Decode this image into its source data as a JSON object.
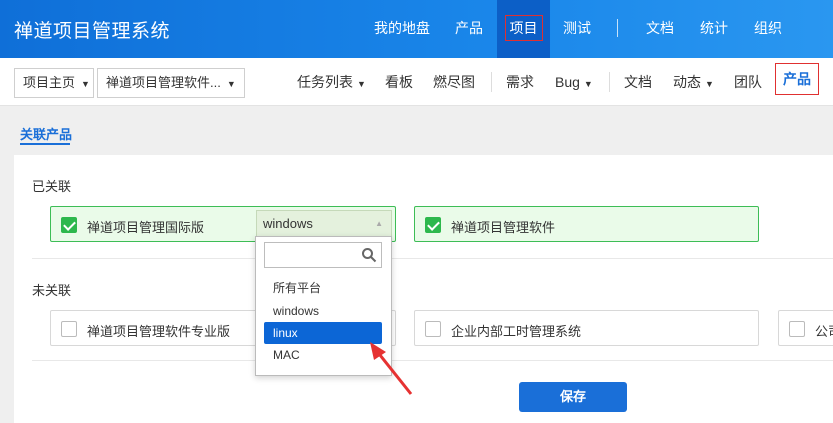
{
  "header": {
    "app_title": "禅道项目管理系统",
    "nav": [
      "我的地盘",
      "产品",
      "项目",
      "测试",
      "文档",
      "统计",
      "组织"
    ],
    "accent": "#1a6fd8"
  },
  "subnav": {
    "crumb1": "项目主页",
    "crumb2": "禅道项目管理软件...",
    "items": [
      "任务列表",
      "看板",
      "燃尽图",
      "需求",
      "Bug",
      "文档",
      "动态",
      "团队",
      "产品"
    ]
  },
  "section_tab": "关联产品",
  "linked": {
    "title": "已关联",
    "products": [
      {
        "name": "禅道项目管理国际版",
        "platform": "windows",
        "checked": true
      },
      {
        "name": "禅道项目管理软件",
        "checked": true
      }
    ]
  },
  "unlinked": {
    "title": "未关联",
    "products": [
      {
        "name": "禅道项目管理软件专业版",
        "checked": false
      },
      {
        "name": "企业内部工时管理系统",
        "checked": false
      },
      {
        "name": "公司",
        "checked": false
      }
    ]
  },
  "platform_dropdown": {
    "search_placeholder": "",
    "options": [
      "所有平台",
      "windows",
      "linux",
      "MAC"
    ],
    "highlighted": "linux"
  },
  "save_label": "保存"
}
